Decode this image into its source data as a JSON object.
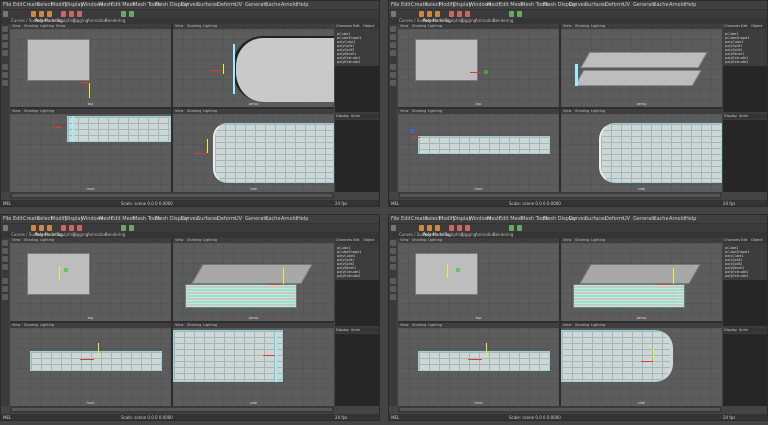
{
  "menu": [
    "File",
    "Edit",
    "Create",
    "Select",
    "Modify",
    "Display",
    "Windows",
    "Mesh",
    "Edit Mesh",
    "Mesh Tools",
    "Mesh Display",
    "Curves",
    "Surfaces",
    "Deform",
    "UV",
    "Generate",
    "Cache",
    "Arnold",
    "Help"
  ],
  "mode_selector": "Modeling",
  "tabs": [
    "Curves / Surfaces",
    "Poly Modeling",
    "Sculpting",
    "Rigging",
    "Animation",
    "Rendering",
    "FX",
    "FX Caching",
    "Custom",
    "Arnold",
    "Bifrost",
    "MASH",
    "Motion Graphics",
    "XGen"
  ],
  "viewport_menu": [
    "View",
    "Shading",
    "Lighting",
    "Show",
    "Renderer",
    "Panels"
  ],
  "viewport_labels": {
    "top": "top",
    "persp": "persp",
    "front": "front",
    "side": "side"
  },
  "outliner_tabs": [
    "Channels",
    "Edit",
    "Object",
    "Show"
  ],
  "outliner_items": [
    "pCube1",
    "pCubeShape1",
    "polyCube1",
    "polySplit1",
    "polySplit2",
    "polyBevel1",
    "polyExtrude1",
    "polyExtrude2"
  ],
  "layers_tabs": [
    "Display",
    "Anim"
  ],
  "status_labels": {
    "mel": "MEL",
    "no_char": "No Character Set",
    "no_anim": "No Anim Layer",
    "fps": "24 fps"
  },
  "panes": [
    {
      "id": "tl",
      "status_text": "Scale: scene 0.0 0 0.0000"
    },
    {
      "id": "tr",
      "status_text": "Scale: scene 0.0 0 0.0000"
    },
    {
      "id": "bl",
      "status_text": "Scale: scene 0.0 0 0.0000"
    },
    {
      "id": "br",
      "status_text": "Scale: scene 0.0 0 0.0000"
    }
  ],
  "colors": {
    "bg": "#444444",
    "viewport": "#5c5c5c",
    "mesh": "#cfd6d6",
    "selection": "#99eeff",
    "axis_x": "#ee3333",
    "axis_y": "#eeee33",
    "axis_z": "#3366ff"
  }
}
